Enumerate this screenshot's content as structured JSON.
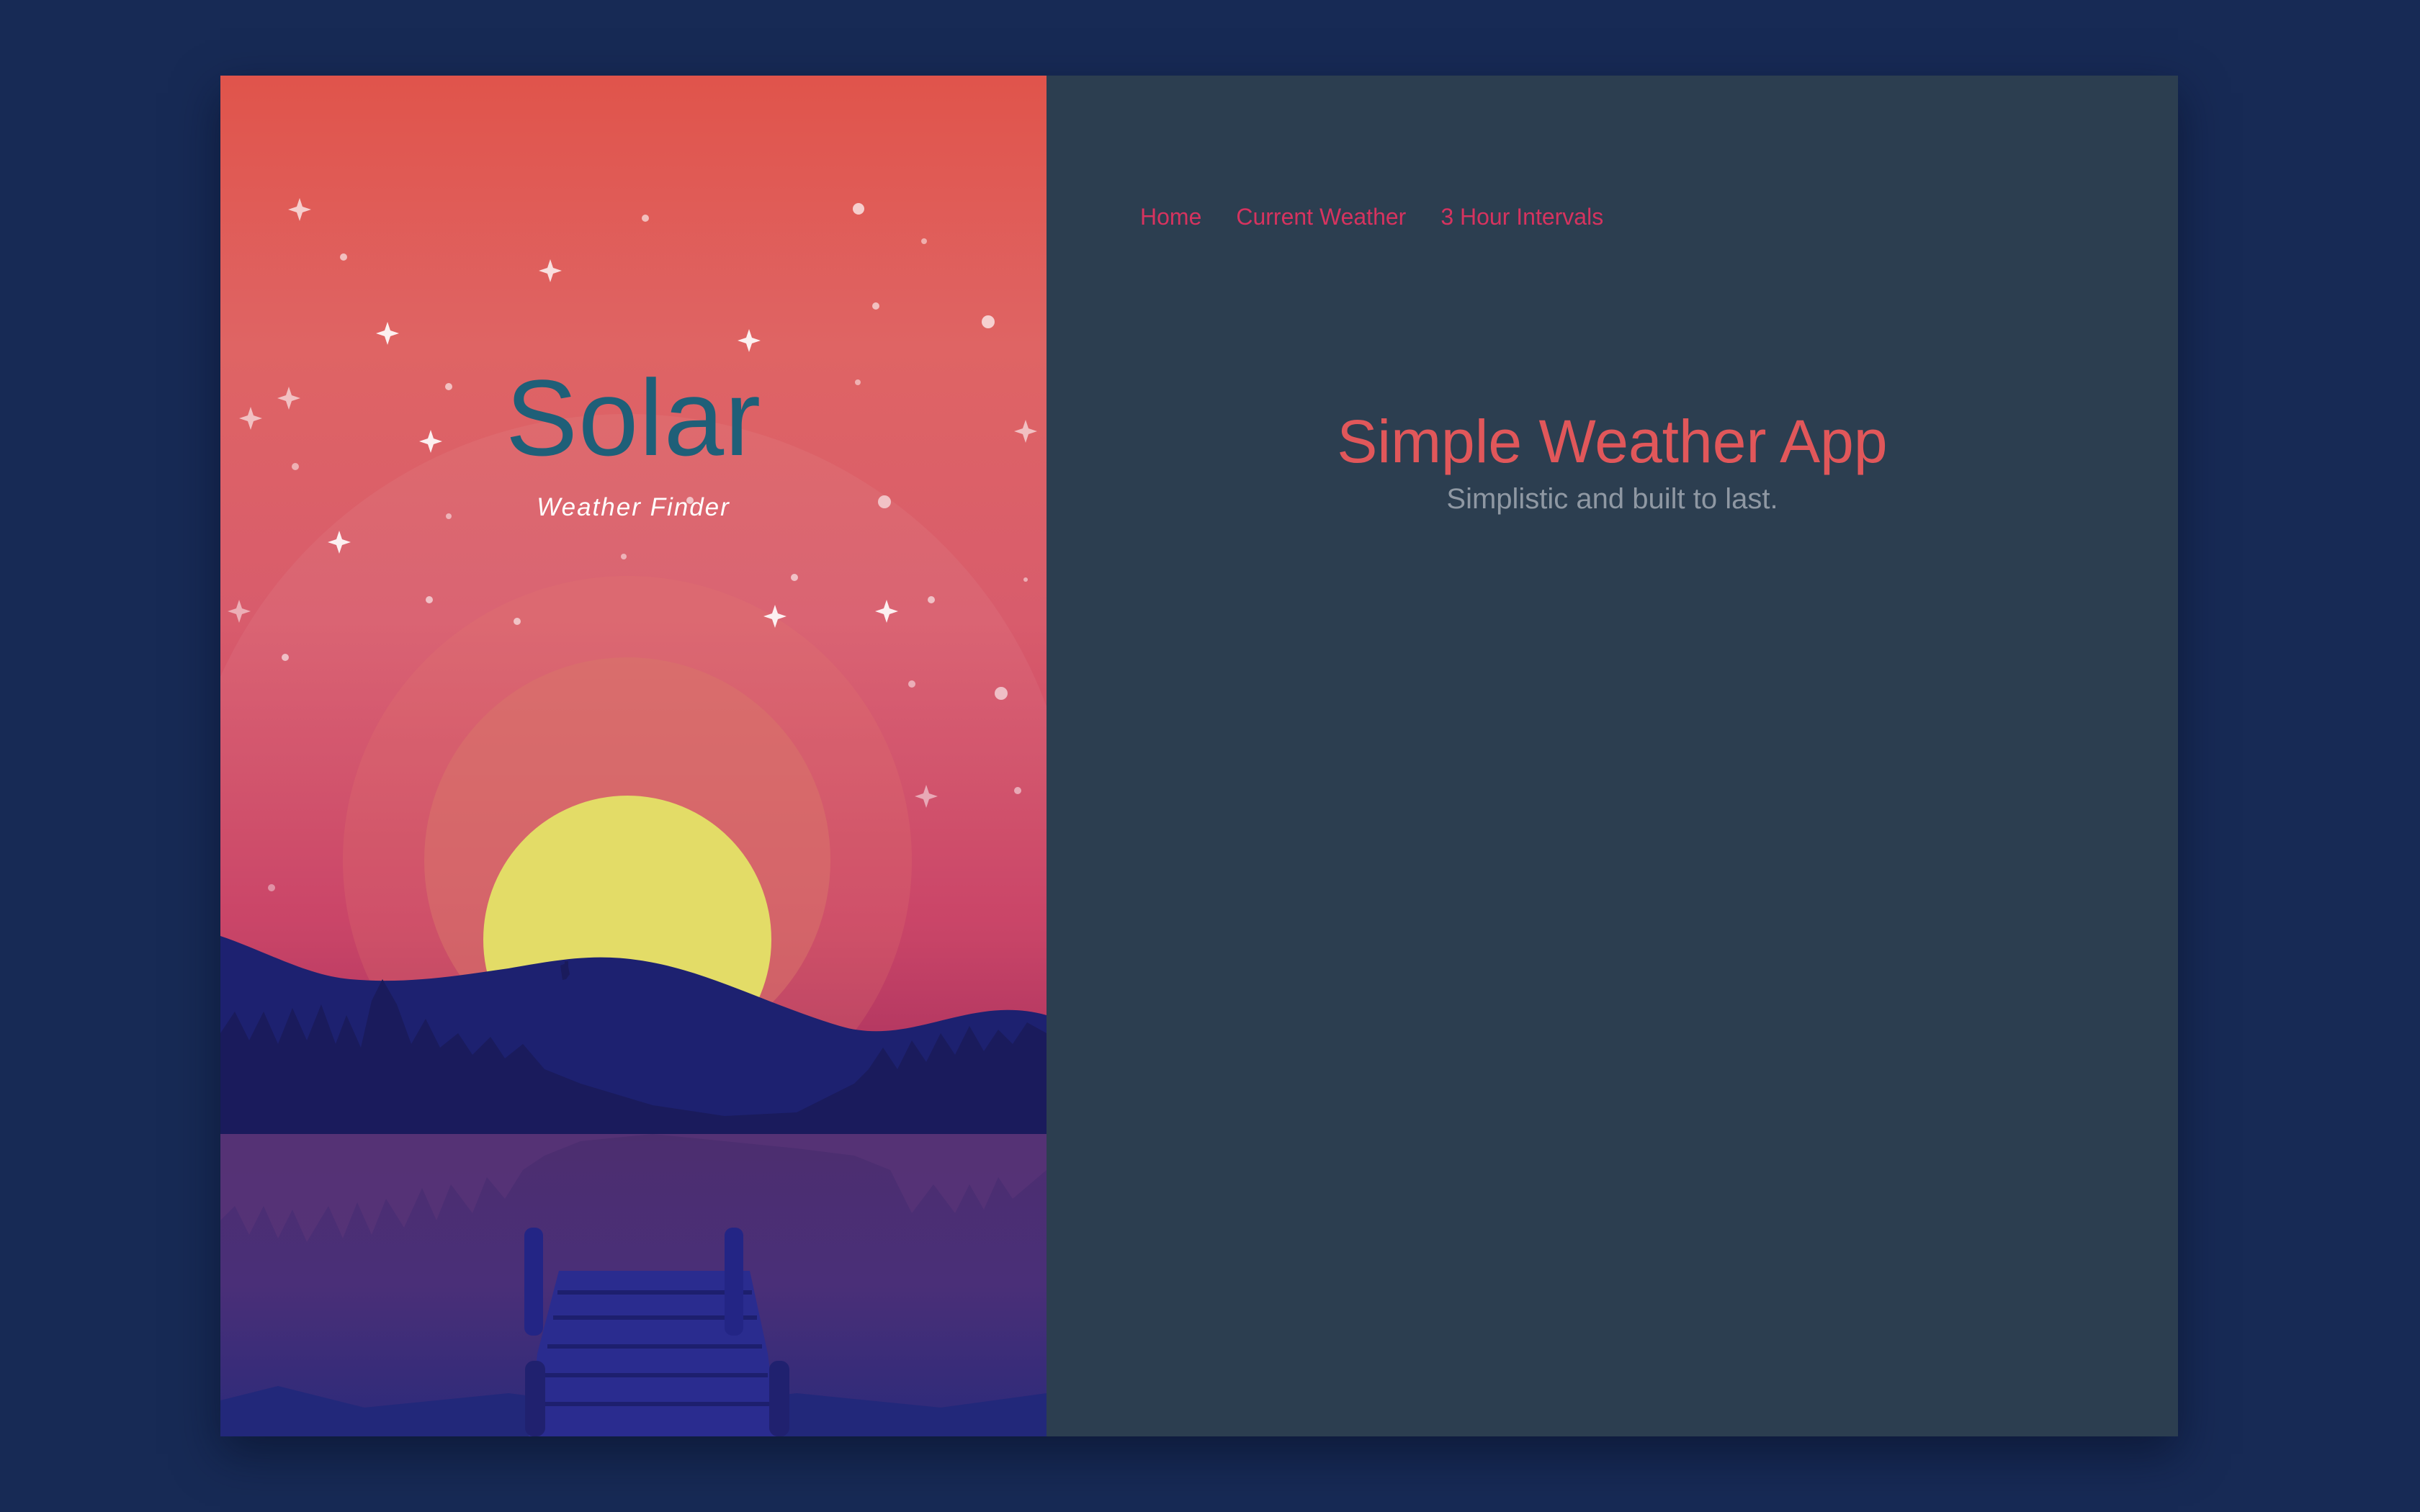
{
  "brand": {
    "title": "Solar",
    "subtitle": "Weather Finder"
  },
  "nav": {
    "items": [
      {
        "label": "Home"
      },
      {
        "label": "Current Weather"
      },
      {
        "label": "3 Hour Intervals"
      }
    ]
  },
  "main": {
    "title": "Simple Weather App",
    "tagline": "Simplistic and built to last."
  },
  "colors": {
    "page_background": "#172a55",
    "content_background": "#2c3e50",
    "nav_link": "#d6335f",
    "title_accent": "#e1575a",
    "tagline": "#8f98a3",
    "brand_title": "#1f5f78",
    "sun": "#e3dc67",
    "mountains": "#1d2170"
  },
  "illustration": {
    "description_icon": "sunset-lake-illustration-icon"
  }
}
